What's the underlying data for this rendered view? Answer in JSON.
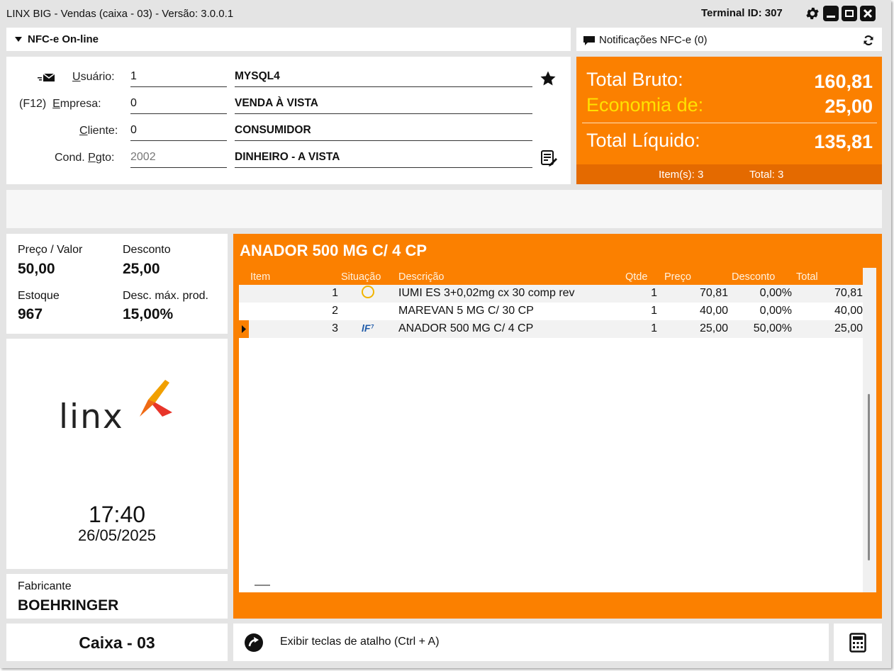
{
  "window": {
    "title": "LINX BIG - Vendas (caixa - 03) - Versão: 3.0.0.1",
    "terminal": "Terminal ID: 307"
  },
  "nfc": {
    "mode_label": "NFC-e On-line",
    "notifications_label": "Notificações NFC-e (0)"
  },
  "customer": {
    "usuario_label": "Usuário:",
    "usuario_code": "1",
    "usuario_desc": "MYSQL4",
    "empresa_shortcut": "(F12)",
    "empresa_label": "Empresa:",
    "empresa_code": "0",
    "empresa_desc": "VENDA À VISTA",
    "cliente_label": "Cliente:",
    "cliente_code": "0",
    "cliente_desc": "CONSUMIDOR",
    "cond_label": "Cond. Pgto:",
    "cond_code": "2002",
    "cond_desc": "DINHEIRO - A VISTA"
  },
  "totals": {
    "bruto_label": "Total Bruto:",
    "bruto_value": "160,81",
    "economia_label": "Economia de:",
    "economia_value": "25,00",
    "liquido_label": "Total Líquido:",
    "liquido_value": "135,81",
    "items_label": "Item(s): 3",
    "total_label": "Total: 3"
  },
  "price": {
    "preco_label": "Preço / Valor",
    "preco_value": "50,00",
    "desconto_label": "Desconto",
    "desconto_value": "25,00",
    "estoque_label": "Estoque",
    "estoque_value": "967",
    "descmax_label": "Desc. máx. prod.",
    "descmax_value": "15,00%"
  },
  "logo": {
    "text": "linx",
    "time": "17:40",
    "date": "26/05/2025"
  },
  "fabricante": {
    "label": "Fabricante",
    "value": "BOEHRINGER"
  },
  "product": {
    "title": "ANADOR 500 MG C/ 4 CP",
    "headers": {
      "item": "Item",
      "situacao": "Situação",
      "descricao": "Descrição",
      "qtde": "Qtde",
      "preco": "Preço",
      "desconto": "Desconto",
      "total": "Total"
    },
    "rows": [
      {
        "item": "1",
        "status": "circle-outline",
        "descricao": "IUMI ES 3+0,02mg cx 30 comp rev",
        "qtde": "1",
        "preco": "70,81",
        "desconto": "0,00%",
        "total": "70,81"
      },
      {
        "item": "2",
        "status": "",
        "descricao": "MAREVAN 5 MG C/ 30 CP",
        "qtde": "1",
        "preco": "40,00",
        "desconto": "0,00%",
        "total": "40,00"
      },
      {
        "item": "3",
        "status": "lf-mark",
        "descricao": "ANADOR 500 MG C/ 4 CP",
        "qtde": "1",
        "preco": "25,00",
        "desconto": "50,00%",
        "total": "25,00"
      }
    ]
  },
  "footer": {
    "caixa": "Caixa - 03",
    "shortcut": "Exibir teclas de atalho (Ctrl + A)"
  },
  "icons": {
    "settings": "gear-icon",
    "minimize": "minimize-icon",
    "restore": "restore-icon",
    "close": "close-icon",
    "dropdown": "triangle-down-icon",
    "notification": "chat-bubble-icon",
    "refresh": "refresh-icon",
    "message": "envelope-icon",
    "favorite": "star-icon",
    "payment_notes": "notepad-edit-icon",
    "shortcut": "arrow-circle-icon",
    "calculator": "calculator-icon",
    "row_pointer": "row-pointer-icon"
  },
  "colors": {
    "accent": "#fb8000",
    "accent_dark": "#e46a00",
    "economia": "#ffe100",
    "status_circle": "#f2b400",
    "lf_mark": "#1e5aa8",
    "logo_flame_top": "#f1a000",
    "logo_flame_bottom": "#e8352a"
  }
}
